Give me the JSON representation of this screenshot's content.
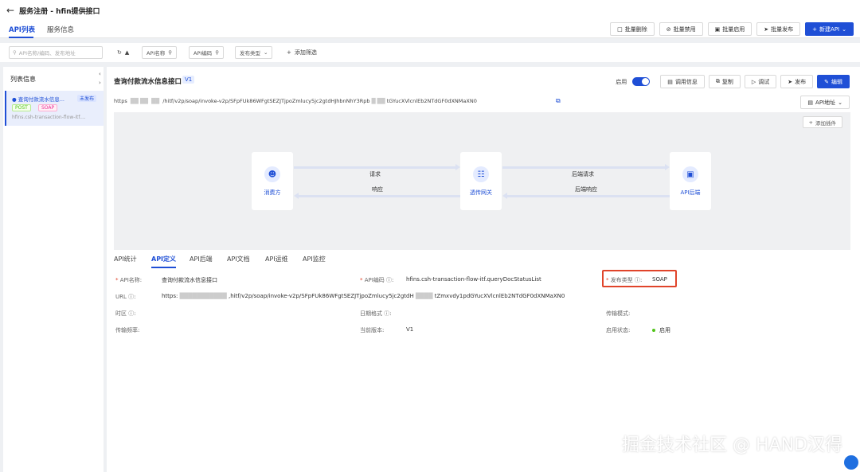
{
  "header": {
    "title": "服务注册 - hfin提供接口"
  },
  "tabs": [
    {
      "label": "API列表"
    },
    {
      "label": "服务信息"
    }
  ],
  "toolbar": {
    "batch_delete": "批量删除",
    "batch_disable": "批量禁用",
    "batch_enable": "批量启用",
    "batch_publish": "批量发布",
    "new_api": "新建API"
  },
  "filters": {
    "search_placeholder": "API名称/编码、发布地址",
    "api_name": "API名称",
    "api_code": "API编码",
    "publish_type": "发布类型",
    "add_filter": "添加筛选"
  },
  "sidebar": {
    "title": "列表信息",
    "items": [
      {
        "name": "查询付款流水信息...",
        "status": "未发布",
        "method": "POST",
        "protocol": "SOAP",
        "code": "hfins.csh-transaction-flow-itf...."
      }
    ]
  },
  "detail": {
    "title": "查询付款流水信息接口",
    "version": "V1",
    "enable_label": "启用",
    "enabled": true,
    "actions": {
      "call_info": "调用信息",
      "copy": "复制",
      "debug": "调试",
      "publish": "发布",
      "edit": "编辑"
    },
    "url_prefix": "https",
    "url": "/hitf/v2p/soap/invoke-v2p/SFpFUk86WFgtSEZJTjpoZmlucy5jc2gtdHJhbnNhY3Rpb",
    "url_suffix": "tGYucXVlcnlEb2NTdGF0dXNMaXN0",
    "api_address": "API地址",
    "add_plugin": "添加插件"
  },
  "flow": {
    "nodes": [
      {
        "label": "消费方",
        "icon": "users-icon"
      },
      {
        "label": "透传网关",
        "icon": "gateway-icon"
      },
      {
        "label": "API后端",
        "icon": "backend-icon"
      }
    ],
    "arrows": [
      {
        "label": "请求"
      },
      {
        "label": "响应"
      },
      {
        "label": "后端请求"
      },
      {
        "label": "后端响应"
      }
    ]
  },
  "detail_tabs": [
    {
      "label": "API统计"
    },
    {
      "label": "API定义"
    },
    {
      "label": "API后端"
    },
    {
      "label": "API文档"
    },
    {
      "label": "API运维"
    },
    {
      "label": "API监控"
    }
  ],
  "fields": {
    "api_name_label": "API名称:",
    "api_name_value": "查询付款流水信息接口",
    "api_code_label": "API编码",
    "api_code_value": "hfins.csh-transaction-flow-itf.queryDocStatusList",
    "publish_type_label": "发布类型",
    "publish_type_value": "SOAP",
    "url_label": "URL",
    "url_value_prefix": "https:",
    "url_value": ",hitf/v2p/soap/invoke-v2p/SFpFUk86WFgtSEZJTjpoZmlucy5jc2gtdH",
    "url_value_suffix": "tZmxvdy1pdGYucXVlcnlEb2NTdGF0dXNMaXN0",
    "timezone_label": "时区",
    "date_format_label": "日期格式",
    "transfer_mode_label": "传输模式:",
    "transfer_freq_label": "传输频率:",
    "current_version_label": "当前版本:",
    "current_version_value": "V1",
    "enable_status_label": "启用状态:",
    "enable_status_value": "启用"
  },
  "watermark": "掘金技术社区 @ HAND汉得",
  "colors": {
    "primary": "#1f4fd6",
    "highlight": "#e0442a",
    "success": "#52c41a"
  }
}
